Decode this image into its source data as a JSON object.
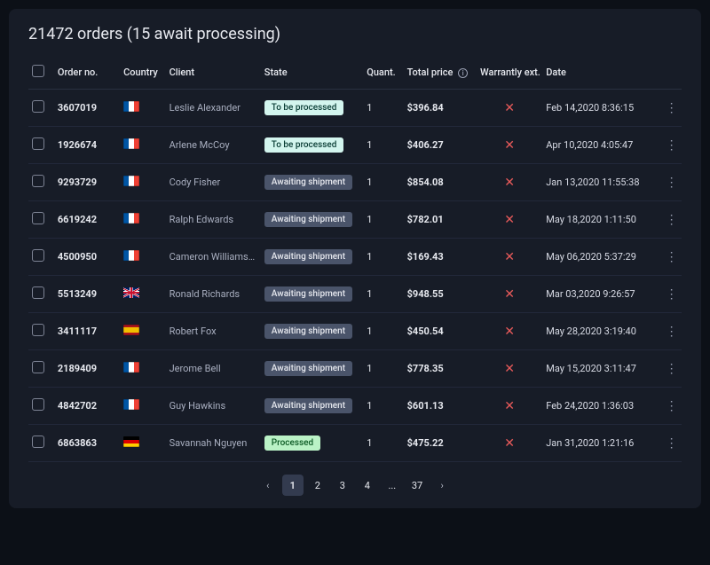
{
  "title": "21472 orders (15 await processing)",
  "columns": {
    "order_no": "Order no.",
    "country": "Country",
    "client": "Client",
    "state": "State",
    "quant": "Quant.",
    "total_price": "Total price",
    "warranty_ext": "Warrantly ext.",
    "date": "Date"
  },
  "state_labels": {
    "to-be-processed": "To be processed",
    "awaiting-shipment": "Awaiting shipment",
    "processed": "Processed"
  },
  "rows": [
    {
      "order_no": "3607019",
      "country": "fr",
      "client": "Leslie Alexander",
      "state": "to-be-processed",
      "quant": "1",
      "price": "$396.84",
      "warranty": false,
      "date": "Feb 14,2020 8:36:15"
    },
    {
      "order_no": "1926674",
      "country": "fr",
      "client": "Arlene McCoy",
      "state": "to-be-processed",
      "quant": "1",
      "price": "$406.27",
      "warranty": false,
      "date": "Apr 10,2020 4:05:47"
    },
    {
      "order_no": "9293729",
      "country": "fr",
      "client": "Cody Fisher",
      "state": "awaiting-shipment",
      "quant": "1",
      "price": "$854.08",
      "warranty": false,
      "date": "Jan 13,2020 11:55:38"
    },
    {
      "order_no": "6619242",
      "country": "fr",
      "client": "Ralph Edwards",
      "state": "awaiting-shipment",
      "quant": "1",
      "price": "$782.01",
      "warranty": false,
      "date": "May 18,2020 1:11:50"
    },
    {
      "order_no": "4500950",
      "country": "fr",
      "client": "Cameron Williamson",
      "state": "awaiting-shipment",
      "quant": "1",
      "price": "$169.43",
      "warranty": false,
      "date": "May 06,2020 5:37:29"
    },
    {
      "order_no": "5513249",
      "country": "uk",
      "client": "Ronald Richards",
      "state": "awaiting-shipment",
      "quant": "1",
      "price": "$948.55",
      "warranty": false,
      "date": "Mar 03,2020 9:26:57"
    },
    {
      "order_no": "3411117",
      "country": "es",
      "client": "Robert Fox",
      "state": "awaiting-shipment",
      "quant": "1",
      "price": "$450.54",
      "warranty": false,
      "date": "May 28,2020 3:19:40"
    },
    {
      "order_no": "2189409",
      "country": "fr",
      "client": "Jerome Bell",
      "state": "awaiting-shipment",
      "quant": "1",
      "price": "$778.35",
      "warranty": false,
      "date": "May 15,2020 3:11:47"
    },
    {
      "order_no": "4842702",
      "country": "fr",
      "client": "Guy Hawkins",
      "state": "awaiting-shipment",
      "quant": "1",
      "price": "$601.13",
      "warranty": false,
      "date": "Feb 24,2020 1:36:03"
    },
    {
      "order_no": "6863863",
      "country": "de",
      "client": "Savannah Nguyen",
      "state": "processed",
      "quant": "1",
      "price": "$475.22",
      "warranty": false,
      "date": "Jan 31,2020 1:21:16"
    }
  ],
  "pagination": {
    "pages": [
      "1",
      "2",
      "3",
      "4",
      "...",
      "37"
    ],
    "active": "1"
  }
}
